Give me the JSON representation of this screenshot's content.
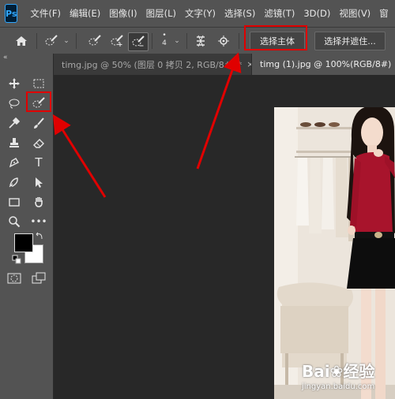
{
  "app": {
    "logo": "Ps"
  },
  "menu": [
    "文件(F)",
    "编辑(E)",
    "图像(I)",
    "图层(L)",
    "文字(Y)",
    "选择(S)",
    "滤镜(T)",
    "3D(D)",
    "视图(V)",
    "窗"
  ],
  "options_bar": {
    "brush_size": "4",
    "select_subject_label": "选择主体",
    "select_and_mask_label": "选择并遮住..."
  },
  "tabs": [
    {
      "title": "timg.jpg @ 50% (图层 0 拷贝 2, RGB/8#) *",
      "close": "×",
      "active": false
    },
    {
      "title": "timg (1).jpg @ 100%(RGB/8#)",
      "close": "×",
      "active": true
    }
  ],
  "tools": [
    "move-tool",
    "marquee-tool",
    "lasso-tool",
    "quick-selection-tool",
    "eyedropper-tool",
    "brush-tool",
    "stamp-tool",
    "eraser-tool",
    "pen-tool",
    "type-tool",
    "smudge-tool",
    "path-selection-tool",
    "rectangle-tool",
    "hand-tool",
    "zoom-tool",
    "more-tools",
    "quick-mask",
    "screen-mode"
  ],
  "tools_panel": {
    "type_tool_glyph": "T",
    "more_glyph": "•••",
    "collapse_glyph": "«"
  },
  "colors": {
    "highlight": "#e00000",
    "panel": "#535353",
    "canvas": "#282828",
    "accent_ps": "#31a8ff"
  },
  "watermark": {
    "brand": "Bai",
    "brand2": "经验",
    "url": "jingyan.baidu.com"
  }
}
